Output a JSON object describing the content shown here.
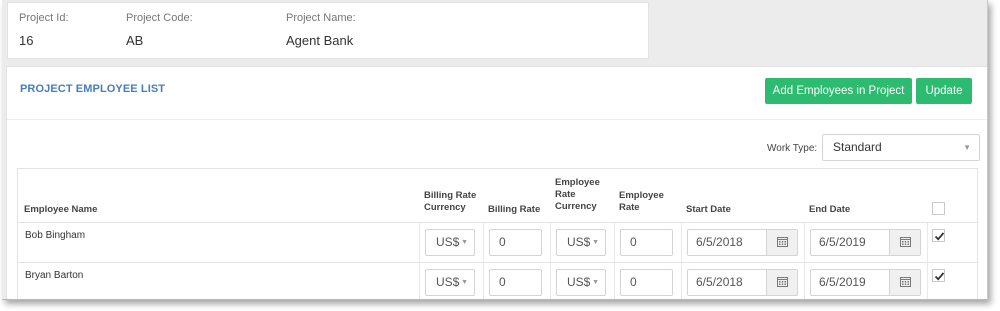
{
  "project": {
    "id_label": "Project Id:",
    "id_value": "16",
    "code_label": "Project Code:",
    "code_value": "AB",
    "name_label": "Project Name:",
    "name_value": "Agent Bank"
  },
  "panel": {
    "title": "PROJECT EMPLOYEE LIST",
    "add_button": "Add Employees in Project",
    "update_button": "Update",
    "accent_color": "#2dbb6f"
  },
  "filter": {
    "work_type_label": "Work Type:",
    "work_type_value": "Standard"
  },
  "table": {
    "headers": {
      "employee_name": "Employee Name",
      "billing_rate_currency": [
        "Billing Rate",
        "Currency"
      ],
      "billing_rate": "Billing Rate",
      "employee_rate_currency": [
        "Employee",
        "Rate",
        "Currency"
      ],
      "employee_rate": [
        "Employee",
        "Rate"
      ],
      "start_date": "Start Date",
      "end_date": "End Date"
    },
    "rows": [
      {
        "name": "Bob Bingham",
        "billing_currency": "US$",
        "billing_rate": "0",
        "employee_currency": "US$",
        "employee_rate": "0",
        "start_date": "6/5/2018",
        "end_date": "6/5/2019",
        "checked": true
      },
      {
        "name": "Bryan Barton",
        "billing_currency": "US$",
        "billing_rate": "0",
        "employee_currency": "US$",
        "employee_rate": "0",
        "start_date": "6/5/2018",
        "end_date": "6/5/2019",
        "checked": true
      }
    ]
  },
  "icons": {
    "select_caret": "caret-down-icon",
    "calendar": "calendar-icon",
    "checkbox_check": "checkmark-icon"
  }
}
